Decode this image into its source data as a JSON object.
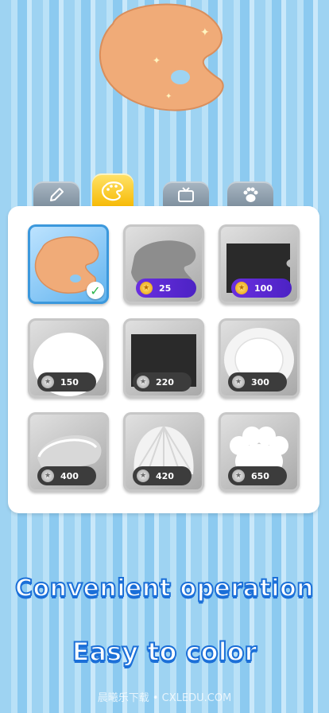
{
  "hero": {
    "icon": "palette-icon",
    "color": "#f0ab78"
  },
  "tabs": [
    {
      "icon": "pencil-icon",
      "active": false
    },
    {
      "icon": "palette-icon",
      "active": true
    },
    {
      "icon": "tv-icon",
      "active": false
    },
    {
      "icon": "paw-icon",
      "active": false
    }
  ],
  "items": [
    {
      "name": "palette",
      "selected": true
    },
    {
      "name": "gray-palette",
      "price": "25",
      "currency": "gold"
    },
    {
      "name": "black-board",
      "price": "100",
      "currency": "gold"
    },
    {
      "name": "round-plate",
      "price": "150",
      "currency": "silver"
    },
    {
      "name": "black-tray",
      "price": "220",
      "currency": "silver"
    },
    {
      "name": "rim-plate",
      "price": "300",
      "currency": "silver"
    },
    {
      "name": "leaf-plate",
      "price": "400",
      "currency": "silver"
    },
    {
      "name": "shell-plate",
      "price": "420",
      "currency": "silver"
    },
    {
      "name": "paw-plate",
      "price": "650",
      "currency": "silver"
    }
  ],
  "captions": {
    "line1": "Convenient operation",
    "line2": "Easy to color"
  },
  "watermark": "晨曦乐下载 • CXLEDU.COM",
  "colors": {
    "gold_badge": "#5a28d6",
    "silver_badge": "#3c3c3c",
    "caption_stroke": "#1b6fd8",
    "tab_active": "#f6b800"
  }
}
